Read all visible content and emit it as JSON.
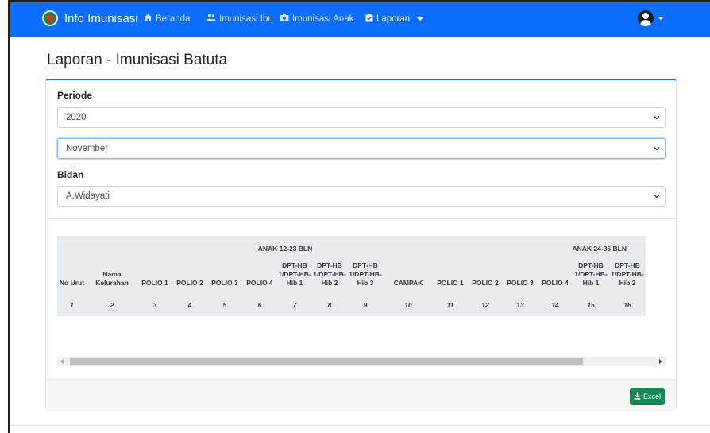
{
  "navbar": {
    "brand": "Info Imunisasi",
    "items": [
      {
        "label": "Beranda",
        "icon": "home-icon"
      },
      {
        "label": "Imunisasi Ibu",
        "icon": "users-icon"
      },
      {
        "label": "Imunisasi Anak",
        "icon": "baby-icon"
      },
      {
        "label": "Laporan",
        "icon": "clipboard-check-icon"
      }
    ],
    "user_icon": "user-circle-icon",
    "color": "#0d6efd"
  },
  "page": {
    "title": "Laporan - Imunisasi Batuta"
  },
  "form": {
    "periode_label": "Periode",
    "year_value": "2020",
    "month_value": "November",
    "bidan_label": "Bidan",
    "bidan_value": "A.Widayati"
  },
  "table": {
    "col_no": "No Urut",
    "col_nama": "Nama Kelurahan",
    "group1": "ANAK 12-23 BLN",
    "group2": "ANAK 24-36 BLN",
    "group1_cols": [
      "POLIO 1",
      "POLIO 2",
      "POLIO 3",
      "POLIO 4",
      "DPT-HB 1/DPT-HB-Hib 1",
      "DPT-HB 1/DPT-HB-Hib 2",
      "DPT-HB 1/DPT-HB-Hib 3",
      "CAMPAK"
    ],
    "group2_cols": [
      "POLIO 1",
      "POLIO 2",
      "POLIO 3",
      "POLIO 4",
      "DPT-HB 1/DPT-HB-Hib 1",
      "DPT-HB 1/DPT-HB-Hib 2"
    ],
    "numbers": [
      "1",
      "2",
      "3",
      "4",
      "5",
      "6",
      "7",
      "8",
      "9",
      "10",
      "11",
      "12",
      "13",
      "14",
      "15",
      "16"
    ]
  },
  "footer": {
    "excel_label": "Excel",
    "excel_color": "#198754"
  }
}
